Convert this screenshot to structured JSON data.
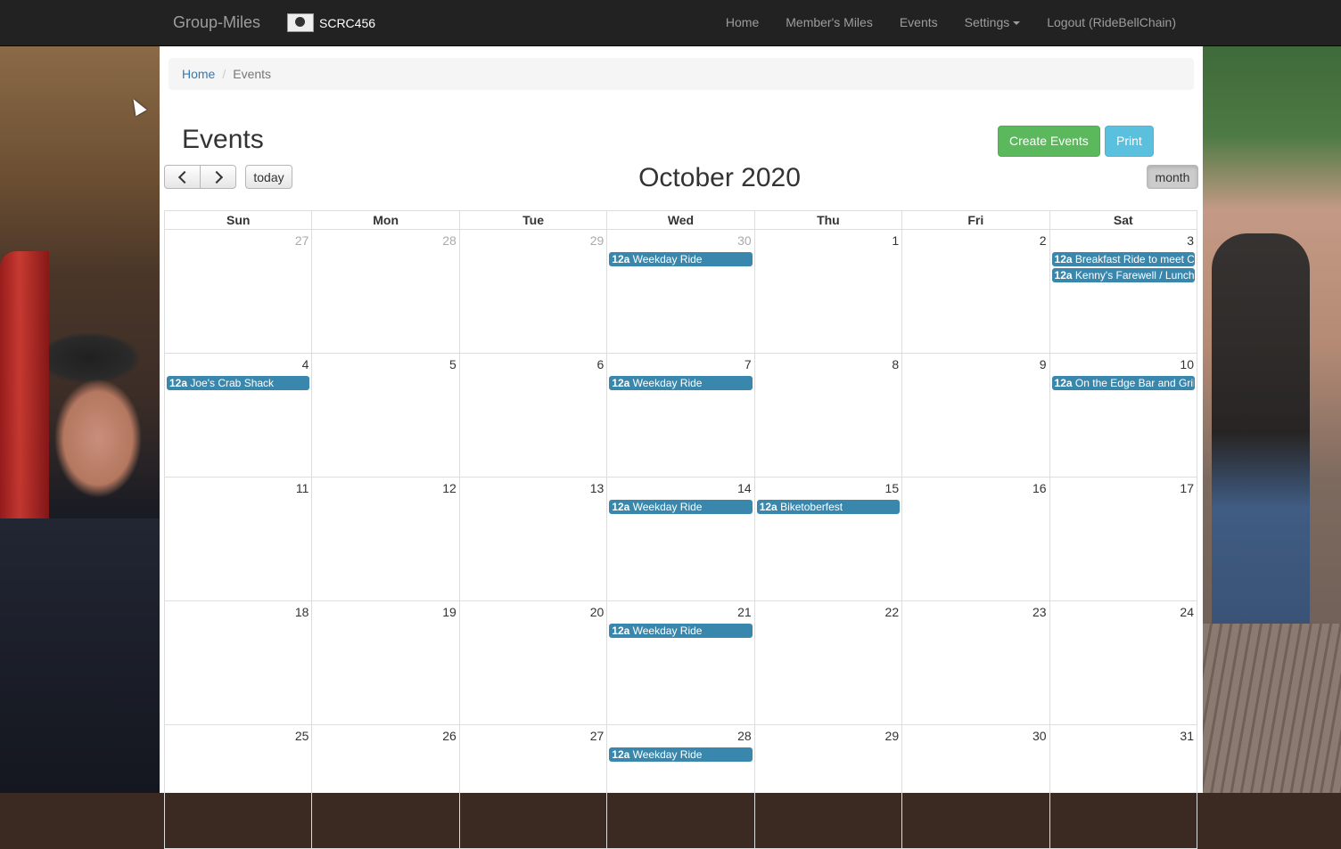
{
  "navbar": {
    "brand": "Group-Miles",
    "club_name": "SCRC456",
    "links": [
      {
        "label": "Home"
      },
      {
        "label": "Member's Miles"
      },
      {
        "label": "Events"
      },
      {
        "label": "Settings"
      },
      {
        "label": "Logout (RideBellChain)"
      }
    ]
  },
  "breadcrumb": {
    "home": "Home",
    "current": "Events"
  },
  "page": {
    "title": "Events",
    "create_button": "Create Events",
    "print_button": "Print"
  },
  "calendar": {
    "title": "October 2020",
    "today_button": "today",
    "view_button": "month",
    "weekdays": [
      "Sun",
      "Mon",
      "Tue",
      "Wed",
      "Thu",
      "Fri",
      "Sat"
    ],
    "weeks": [
      [
        {
          "day": "27",
          "other": true,
          "events": []
        },
        {
          "day": "28",
          "other": true,
          "events": []
        },
        {
          "day": "29",
          "other": true,
          "events": []
        },
        {
          "day": "30",
          "other": true,
          "events": [
            {
              "time": "12a",
              "title": "Weekday Ride"
            }
          ]
        },
        {
          "day": "1",
          "other": false,
          "events": []
        },
        {
          "day": "2",
          "other": false,
          "events": []
        },
        {
          "day": "3",
          "other": false,
          "events": [
            {
              "time": "12a",
              "title": "Breakfast Ride to meet Cl"
            },
            {
              "time": "12a",
              "title": "Kenny's Farewell / Lunch"
            }
          ]
        }
      ],
      [
        {
          "day": "4",
          "other": false,
          "events": [
            {
              "time": "12a",
              "title": "Joe's Crab Shack"
            }
          ]
        },
        {
          "day": "5",
          "other": false,
          "events": []
        },
        {
          "day": "6",
          "other": false,
          "events": []
        },
        {
          "day": "7",
          "other": false,
          "events": [
            {
              "time": "12a",
              "title": "Weekday Ride"
            }
          ]
        },
        {
          "day": "8",
          "other": false,
          "events": []
        },
        {
          "day": "9",
          "other": false,
          "events": []
        },
        {
          "day": "10",
          "other": false,
          "events": [
            {
              "time": "12a",
              "title": "On the Edge Bar and Gril"
            }
          ]
        }
      ],
      [
        {
          "day": "11",
          "other": false,
          "events": []
        },
        {
          "day": "12",
          "other": false,
          "events": []
        },
        {
          "day": "13",
          "other": false,
          "events": []
        },
        {
          "day": "14",
          "other": false,
          "events": [
            {
              "time": "12a",
              "title": "Weekday Ride"
            }
          ]
        },
        {
          "day": "15",
          "other": false,
          "events": [
            {
              "time": "12a",
              "title": "Biketoberfest"
            }
          ]
        },
        {
          "day": "16",
          "other": false,
          "events": []
        },
        {
          "day": "17",
          "other": false,
          "events": []
        }
      ],
      [
        {
          "day": "18",
          "other": false,
          "events": []
        },
        {
          "day": "19",
          "other": false,
          "events": []
        },
        {
          "day": "20",
          "other": false,
          "events": []
        },
        {
          "day": "21",
          "other": false,
          "events": [
            {
              "time": "12a",
              "title": "Weekday Ride"
            }
          ]
        },
        {
          "day": "22",
          "other": false,
          "events": []
        },
        {
          "day": "23",
          "other": false,
          "events": []
        },
        {
          "day": "24",
          "other": false,
          "events": []
        }
      ],
      [
        {
          "day": "25",
          "other": false,
          "events": []
        },
        {
          "day": "26",
          "other": false,
          "events": []
        },
        {
          "day": "27",
          "other": false,
          "events": []
        },
        {
          "day": "28",
          "other": false,
          "events": [
            {
              "time": "12a",
              "title": "Weekday Ride"
            }
          ]
        },
        {
          "day": "29",
          "other": false,
          "events": []
        },
        {
          "day": "30",
          "other": false,
          "events": []
        },
        {
          "day": "31",
          "other": false,
          "events": []
        }
      ]
    ]
  }
}
